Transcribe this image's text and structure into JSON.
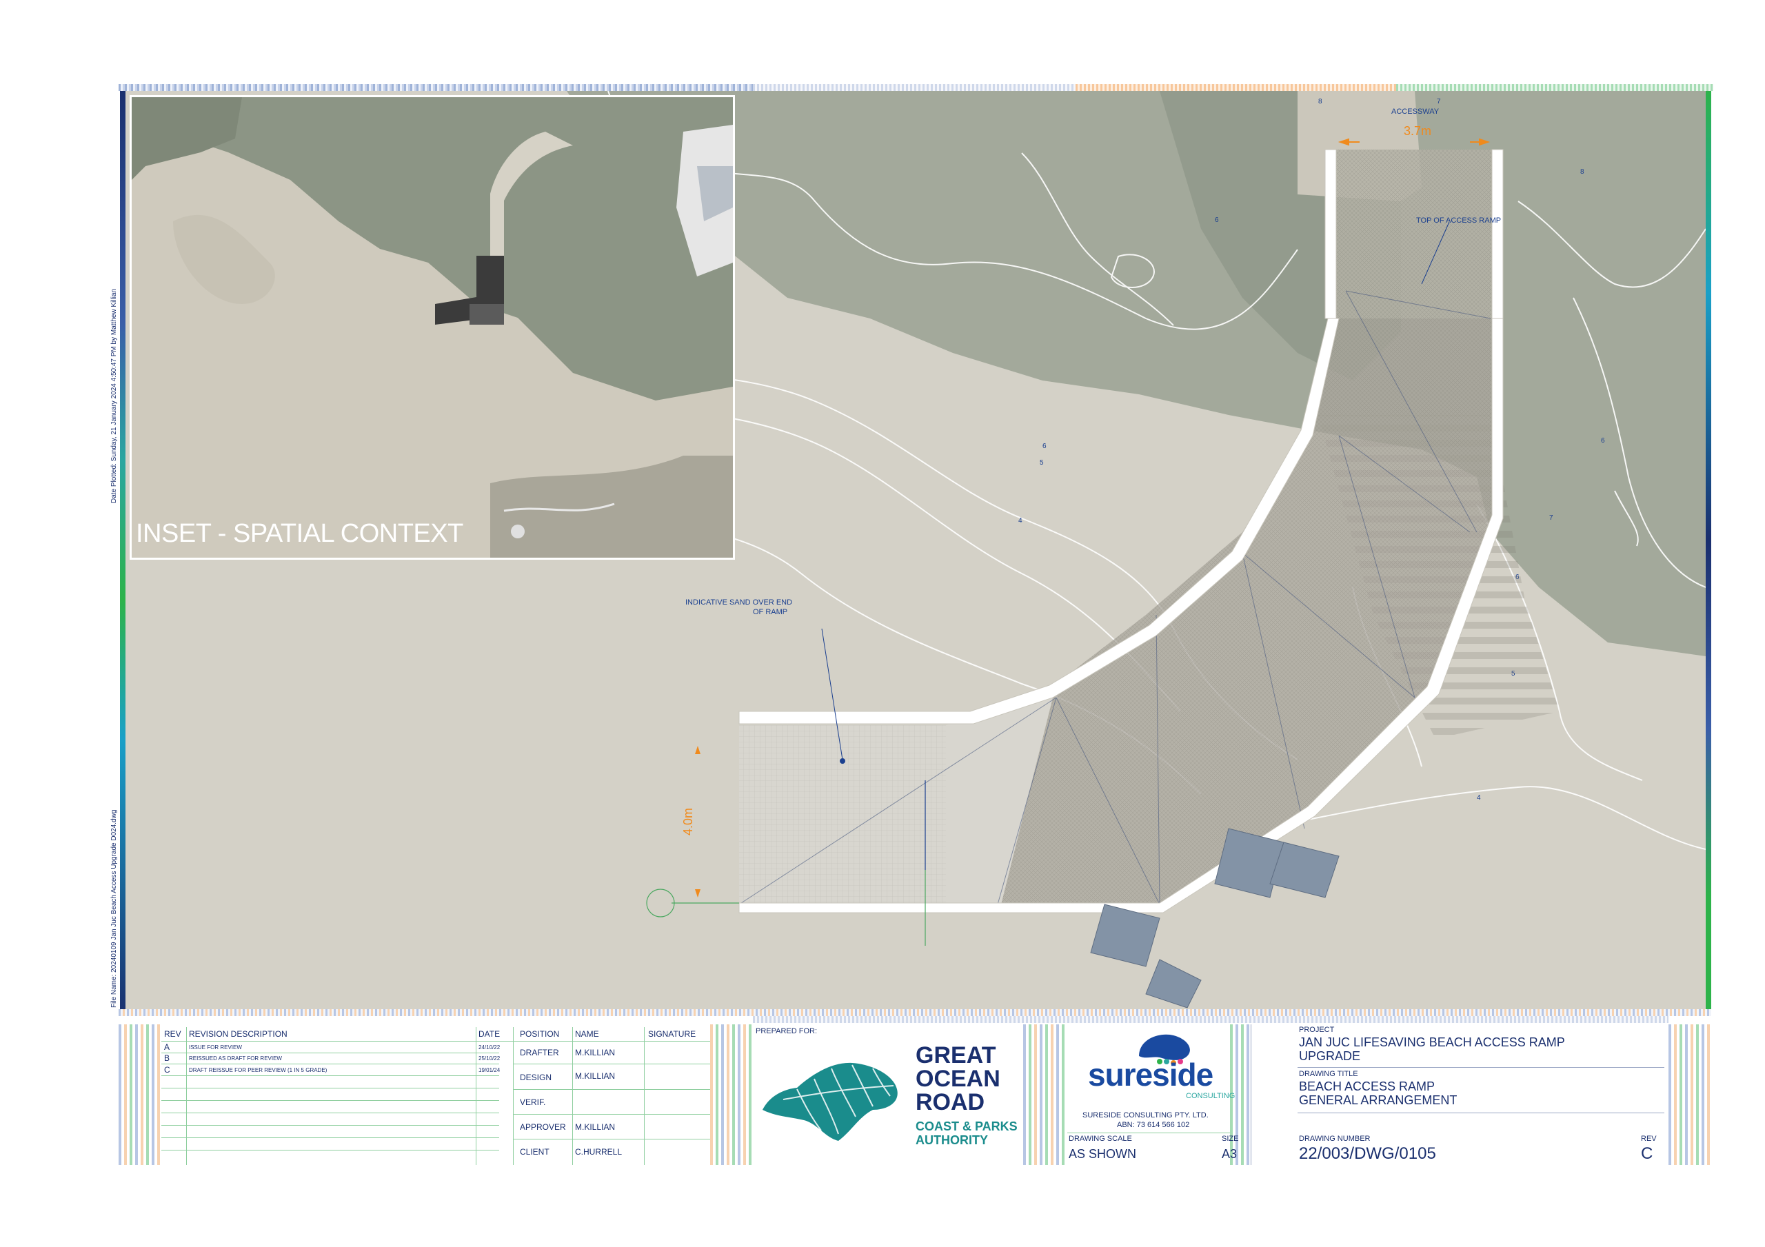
{
  "side_text": {
    "date_plotted": "Date Plotted: Sunday, 21 January 2024 4:50:47 PM by Matthew Killian",
    "file_name": "File Name: 20240109 Jan Juc Beach Access Upgrade D024.dwg"
  },
  "inset": {
    "label": "INSET - SPATIAL CONTEXT"
  },
  "annotations": {
    "accessway": "ACCESSWAY",
    "accessway_width": "3.7m",
    "top_of_ramp": "TOP OF ACCESS RAMP",
    "sand_note_line1": "INDICATIVE SAND OVER END",
    "sand_note_line2": "OF RAMP",
    "ramp_width": "4.0m"
  },
  "contour_labels": [
    "8",
    "7",
    "8",
    "6",
    "6",
    "5",
    "4",
    "6",
    "7",
    "6",
    "5",
    "4"
  ],
  "colors": {
    "frame_green": "#2db34a",
    "frame_navy": "#1a2f6e",
    "dimension_orange": "#f08a1c",
    "annotation_blue": "#1a3f8f",
    "gora_teal": "#1a8c8c"
  },
  "revision_table": {
    "headers": {
      "rev": "REV",
      "description": "REVISION DESCRIPTION",
      "date": "DATE"
    },
    "rows": [
      {
        "rev": "A",
        "description": "ISSUE FOR REVIEW",
        "date": "24/10/22"
      },
      {
        "rev": "B",
        "description": "REISSUED AS DRAFT FOR REVIEW",
        "date": "25/10/22"
      },
      {
        "rev": "C",
        "description": "DRAFT REISSUE FOR PEER REVIEW (1 IN 5 GRADE)",
        "date": "19/01/24"
      }
    ]
  },
  "signoff_table": {
    "headers": {
      "position": "POSITION",
      "name": "NAME",
      "signature": "SIGNATURE"
    },
    "rows": [
      {
        "position": "DRAFTER",
        "name": "M.KILLIAN"
      },
      {
        "position": "DESIGN",
        "name": "M.KILLIAN"
      },
      {
        "position": "VERIF.",
        "name": ""
      },
      {
        "position": "APPROVER",
        "name": "M.KILLIAN"
      },
      {
        "position": "CLIENT",
        "name": "C.HURRELL"
      }
    ]
  },
  "client": {
    "prepared_for": "PREPARED FOR:",
    "name_line1": "GREAT",
    "name_line2": "OCEAN",
    "name_line3": "ROAD",
    "sub_line1": "COAST & PARKS",
    "sub_line2": "AUTHORITY"
  },
  "consultant": {
    "logo_text": "sureside",
    "logo_sub": "CONSULTING",
    "company": "SURESIDE CONSULTING PTY. LTD.",
    "abn": "ABN: 73 614 566 102"
  },
  "drawing_info": {
    "scale_label": "DRAWING SCALE",
    "scale_value": "AS SHOWN",
    "size_label": "SIZE",
    "size_value": "A3",
    "project_label": "PROJECT",
    "project_line1": "JAN JUC LIFESAVING BEACH ACCESS RAMP",
    "project_line2": "UPGRADE",
    "title_label": "DRAWING TITLE",
    "title_line1": "BEACH ACCESS RAMP",
    "title_line2": "GENERAL ARRANGEMENT",
    "number_label": "DRAWING NUMBER",
    "number_value": "22/003/DWG/0105",
    "rev_label": "REV",
    "rev_value": "C"
  }
}
